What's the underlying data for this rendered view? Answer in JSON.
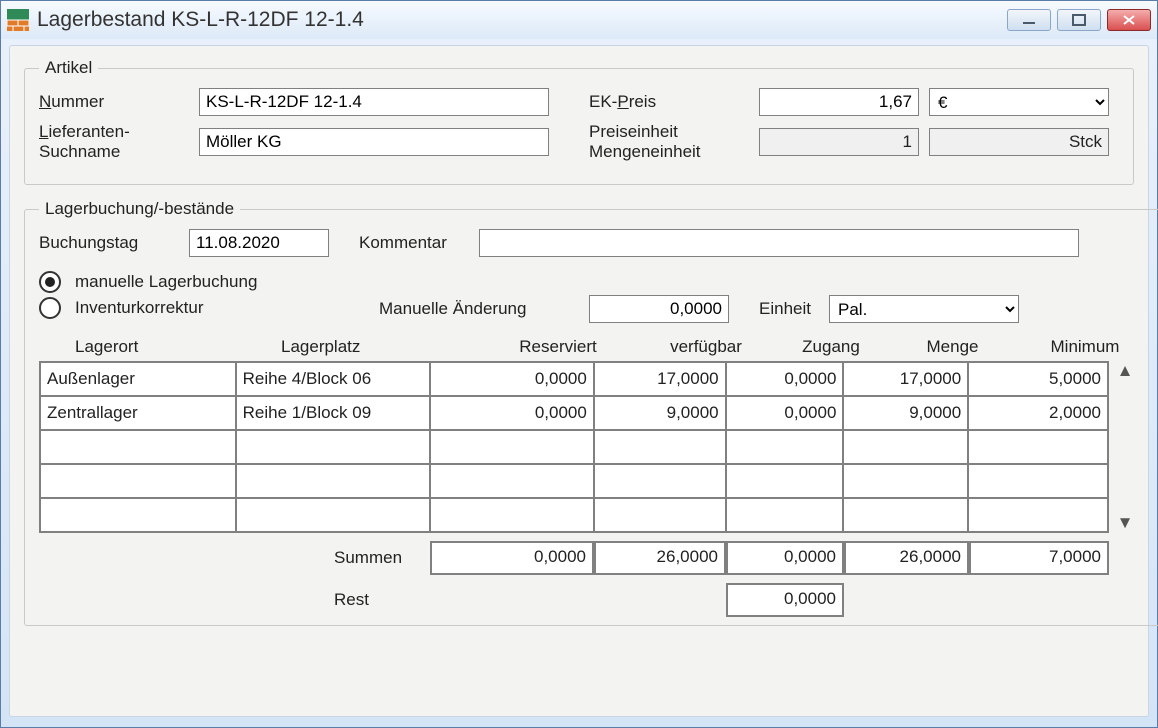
{
  "window": {
    "title": "Lagerbestand KS-L-R-12DF 12-1.4"
  },
  "artikel_group": {
    "legend": "Artikel",
    "nummer_label_pre": "N",
    "nummer_label_post": "ummer",
    "nummer_value": "KS-L-R-12DF 12-1.4",
    "lieferant_label_pre": "L",
    "lieferant_label_post": "ieferanten-",
    "lieferant_label2": "Suchname",
    "lieferant_value": "Möller KG",
    "ekpreis_label_pre": "EK-",
    "ekpreis_label_u": "P",
    "ekpreis_label_post": "reis",
    "ekpreis_value": "1,67",
    "currency": "€",
    "preiseinheit_label": "Preiseinheit",
    "preiseinheit_value": "1",
    "mengeneinheit_label": "Mengeneinheit",
    "mengeneinheit_value": "Stck"
  },
  "lager_group": {
    "legend": "Lagerbuchung/-bestände",
    "buchungstag_label": "Buchungstag",
    "buchungstag_value": "11.08.2020",
    "kommentar_label": "Kommentar",
    "kommentar_value": "",
    "radio_manuell": "manuelle Lagerbuchung",
    "radio_inventur": "Inventurkorrektur",
    "manuelle_aenderung_label": "Manuelle Änderung",
    "manuelle_aenderung_value": "0,0000",
    "einheit_label": "Einheit",
    "einheit_value": "Pal.",
    "headers": [
      "Lagerort",
      "Lagerplatz",
      "Reserviert",
      "verfügbar",
      "Zugang",
      "Menge",
      "Minimum"
    ],
    "rows": [
      {
        "ort": "Außenlager",
        "platz": "Reihe 4/Block 06",
        "res": "0,0000",
        "verf": "17,0000",
        "zu": "0,0000",
        "menge": "17,0000",
        "min": "5,0000"
      },
      {
        "ort": "Zentrallager",
        "platz": "Reihe 1/Block 09",
        "res": "0,0000",
        "verf": "9,0000",
        "zu": "0,0000",
        "menge": "9,0000",
        "min": "2,0000"
      },
      {
        "ort": "",
        "platz": "",
        "res": "",
        "verf": "",
        "zu": "",
        "menge": "",
        "min": ""
      },
      {
        "ort": "",
        "platz": "",
        "res": "",
        "verf": "",
        "zu": "",
        "menge": "",
        "min": ""
      },
      {
        "ort": "",
        "platz": "",
        "res": "",
        "verf": "",
        "zu": "",
        "menge": "",
        "min": ""
      }
    ],
    "summen_label": "Summen",
    "sums": [
      "0,0000",
      "26,0000",
      "0,0000",
      "26,0000",
      "7,0000"
    ],
    "rest_label": "Rest",
    "rest_value": "0,0000"
  }
}
